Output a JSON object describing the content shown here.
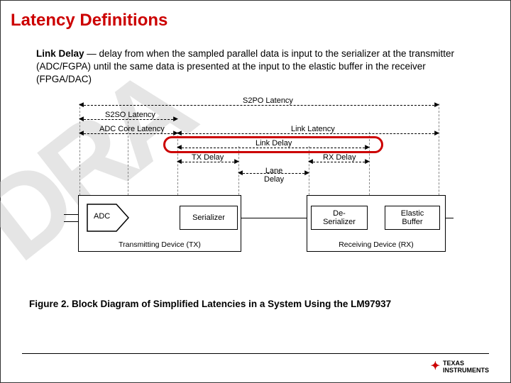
{
  "title": "Latency Definitions",
  "definition": {
    "term": "Link Delay",
    "sep": " — ",
    "text": "delay from when the sampled parallel data is input to the serializer at the transmitter (ADC/FGPA) until the same data is presented at the input to the elastic buffer in the receiver (FPGA/DAC)"
  },
  "labels": {
    "s2po": "S2PO Latency",
    "s2so": "S2SO Latency",
    "adc_core": "ADC Core Latency",
    "link_latency": "Link Latency",
    "link_delay": "Link Delay",
    "tx_delay": "TX Delay",
    "rx_delay": "RX Delay",
    "lane_delay": "Lane\nDelay"
  },
  "blocks": {
    "adc": "ADC",
    "serializer": "Serializer",
    "deserializer": "De-\nSerializer",
    "elastic": "Elastic\nBuffer"
  },
  "devices": {
    "tx": "Transmitting Device (TX)",
    "rx": "Receiving Device (RX)"
  },
  "caption": "Figure 2. Block Diagram of Simplified Latencies in a System Using the LM97937",
  "footer": {
    "brand_top": "TEXAS",
    "brand_bottom": "INSTRUMENTS"
  },
  "watermark": "DRA"
}
